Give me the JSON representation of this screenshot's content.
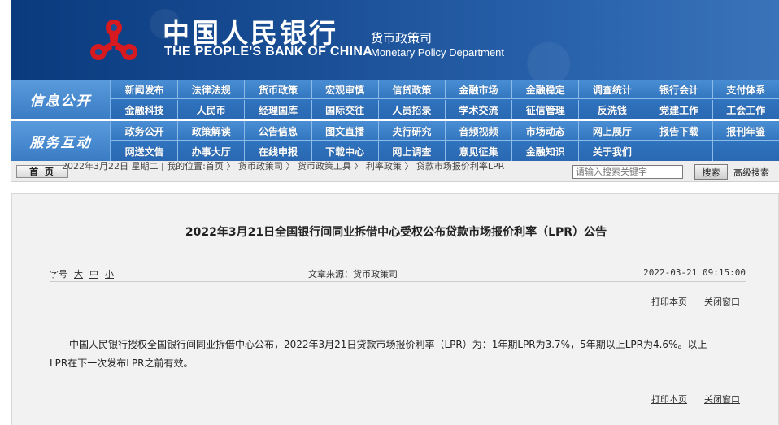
{
  "header": {
    "bank_name_cn": "中国人民银行",
    "bank_name_en": "THE PEOPLE'S BANK OF CHINA",
    "department_cn": "货币政策司",
    "department_en": "Monetary Policy Department"
  },
  "nav": {
    "sections": [
      {
        "label": "信息公开",
        "rows": [
          [
            "新闻发布",
            "法律法规",
            "货币政策",
            "宏观审慎",
            "信贷政策",
            "金融市场",
            "金融稳定",
            "调查统计",
            "银行会计",
            "支付体系"
          ],
          [
            "金融科技",
            "人民币",
            "经理国库",
            "国际交往",
            "人员招录",
            "学术交流",
            "征信管理",
            "反洗钱",
            "党建工作",
            "工会工作"
          ]
        ]
      },
      {
        "label": "服务互动",
        "rows": [
          [
            "政务公开",
            "政策解读",
            "公告信息",
            "图文直播",
            "央行研究",
            "音频视频",
            "市场动态",
            "网上展厅",
            "报告下载",
            "报刊年鉴"
          ],
          [
            "网送文告",
            "办事大厅",
            "在线申报",
            "下载中心",
            "网上调查",
            "意见征集",
            "金融知识",
            "关于我们",
            "",
            ""
          ]
        ]
      }
    ]
  },
  "breadcrumb": {
    "home_label": "首 页",
    "text": "2022年3月22日 星期二 | 我的位置:首页 〉 货币政策司 〉 货币政策工具 〉 利率政策 〉 贷款市场报价利率LPR"
  },
  "search": {
    "placeholder": "请输入搜索关键字",
    "button_label": "搜索",
    "advanced_label": "高级搜索"
  },
  "article": {
    "title": "2022年3月21日全国银行间同业拆借中心受权公布贷款市场报价利率（LPR）公告",
    "font_label": "字号",
    "font_sizes": [
      "大",
      "中",
      "小"
    ],
    "source": "文章来源：货币政策司",
    "date": "2022-03-21 09:15:00",
    "print_label": "打印本页",
    "close_label": "关闭窗口",
    "body": "中国人民银行授权全国银行间同业拆借中心公布，2022年3月21日贷款市场报价利率（LPR）为：1年期LPR为3.7%，5年期以上LPR为4.6%。以上LPR在下一次发布LPR之前有效。"
  },
  "colors": {
    "banner": "#1a4f96",
    "nav": "#2f72bd",
    "content_bg": "#f2f2f2"
  }
}
